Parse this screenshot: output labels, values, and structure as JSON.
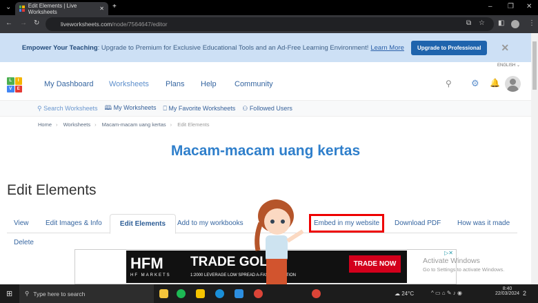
{
  "browser": {
    "tab_title": "Edit Elements | Live Worksheets",
    "url_host": "liveworksheets.com",
    "url_path": "/node/7564647/editor"
  },
  "banner": {
    "lead": "Empower Your Teaching",
    "text": ": Upgrade to Premium for Exclusive Educational Tools and an Ad-Free Learning Environment!",
    "link": "Learn More",
    "button": "Upgrade to Professional",
    "close": "✕"
  },
  "language": "ENGLISH ⌄",
  "logo": [
    "L",
    "I",
    "V",
    "E"
  ],
  "nav": [
    "My Dashboard",
    "Worksheets",
    "Plans",
    "Help",
    "Community"
  ],
  "subnav": [
    "Search Worksheets",
    "My Worksheets",
    "My Favorite Worksheets",
    "Followed Users"
  ],
  "breadcrumb": [
    "Home",
    "Worksheets",
    "Macam-macam uang kertas",
    "Edit Elements"
  ],
  "worksheet_title": "Macam-macam uang kertas",
  "page_heading": "Edit Elements",
  "tabs": [
    "View",
    "Edit Images & Info",
    "Edit Elements",
    "Add to my workbooks",
    "Embed in my website",
    "Download PDF",
    "How was it made",
    "Delete"
  ],
  "ad": {
    "brand": "HFM",
    "brand_sub": "HF MARKETS",
    "headline": "TRADE GOL",
    "sub": "1:2000 LEVERAGE   LOW SPREAD   A-FAST EXECUTION",
    "cta": "TRADE NOW"
  },
  "watermark": {
    "line1": "Activate Windows",
    "line2": "Go to Settings to activate Windows."
  },
  "taskbar": {
    "search": "Type here to search",
    "weather": "24°C",
    "time": "8:40",
    "date": "22/03/2024",
    "notifications": "2"
  },
  "colors": {
    "accent": "#2f7fcb",
    "highlight": "#e00000",
    "banner": "#cde0f5"
  }
}
